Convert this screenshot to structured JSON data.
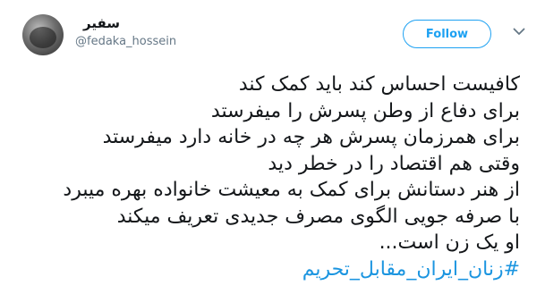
{
  "author": {
    "display_name": "سفیر",
    "handle": "@fedaka_hossein"
  },
  "follow_label": "Follow",
  "icons": {
    "chevron": "chevron-down-icon",
    "avatar": "avatar"
  },
  "colors": {
    "accent": "#1da1f2",
    "hashtag": "#1b95e0",
    "text": "#14171a",
    "muted": "#657786"
  },
  "tweet": {
    "lines": [
      "کافیست احساس کند باید کمک کند",
      "برای دفاع از وطن پسرش را میفرستد",
      "برای همرزمان پسرش هر چه در خانه دارد میفرستد",
      "وقتی هم اقتصاد را در خطر دید",
      "از هنر دستانش برای کمک به معیشت خانواده بهره میبرد",
      "با صرفه جویی الگوی مصرف جدیدی تعریف میکند",
      "او یک زن است..."
    ],
    "hashtag": "#زنان_ایران_مقابل_تحریم"
  }
}
